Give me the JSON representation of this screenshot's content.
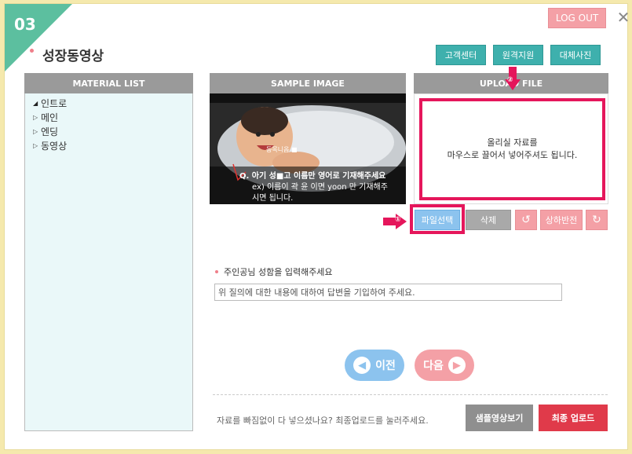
{
  "step": {
    "number": "03"
  },
  "header": {
    "logout_label": "LOG OUT",
    "close_icon": "close-icon",
    "title": "성장동영상",
    "buttons": [
      {
        "label": "고객센터"
      },
      {
        "label": "원격지원"
      },
      {
        "label": "대체사진"
      }
    ]
  },
  "material_list": {
    "title": "MATERIAL LIST",
    "items": [
      {
        "label": "인트로",
        "expanded": true
      },
      {
        "label": "메인",
        "expanded": false
      },
      {
        "label": "엔딩",
        "expanded": false
      },
      {
        "label": "동영상",
        "expanded": false
      }
    ]
  },
  "sample": {
    "title": "SAMPLE IMAGE",
    "overlay_small": "동목니옵 ■",
    "caption_line1": "Q. 아기 성■고 이름만 영어로 기재해주세요",
    "caption_line2": "ex) 이름이 곽 윤 이면 yoon 만 기재해주",
    "caption_line3": "시면 됩니다."
  },
  "upload": {
    "title": "UPLOAD FILE",
    "marker": "②",
    "hint_line1": "올리실 자료를",
    "hint_line2": "마우스로 끌어서 넣어주셔도 됩니다."
  },
  "actions": {
    "marker": "①",
    "select_file": "파일선택",
    "delete": "삭제",
    "rotate_left_icon": "rotate-left-icon",
    "flip": "상하반전",
    "rotate_right_icon": "rotate-right-icon"
  },
  "question": {
    "label": "주인공님 성함을 입력해주세요",
    "input_value": "위 질의에 대한 내용에 대하여 답변을 기입하여 주세요."
  },
  "navigation": {
    "prev_label": "이전",
    "next_label": "다음"
  },
  "footer": {
    "notice": "자료를 빠짐없이 다 넣으셨나요? 최종업로드를 눌러주세요.",
    "preview_label": "샘플영상보기",
    "final_upload_label": "최종 업로드"
  },
  "colors": {
    "teal": "#3eb0ad",
    "pink": "#f4a0a6",
    "highlight": "#e5165b",
    "blue": "#8cc3ee",
    "red": "#e03a4a",
    "gray": "#8f8f8f"
  }
}
